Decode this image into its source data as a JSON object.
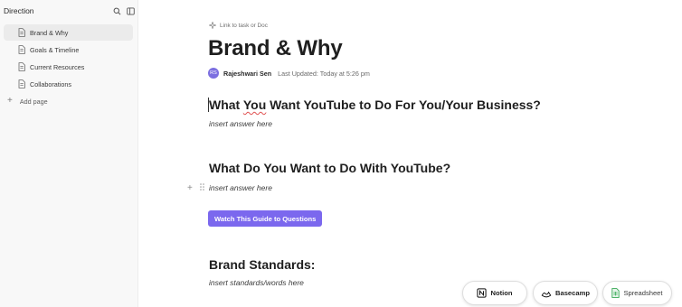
{
  "sidebar": {
    "title": "Direction",
    "items": [
      {
        "label": "Brand & Why",
        "active": true
      },
      {
        "label": "Goals & Timeline",
        "active": false
      },
      {
        "label": "Current Resources",
        "active": false
      },
      {
        "label": "Collaborations",
        "active": false
      }
    ],
    "add_page_label": "Add page",
    "icons": [
      "search-icon",
      "sidebar-toggle-icon",
      "document-icon",
      "plus-icon"
    ]
  },
  "doc": {
    "link_label": "Link to task or Doc",
    "title": "Brand & Why",
    "author_initials": "RS",
    "author": "Rajeshwari Sen",
    "last_updated": "Last Updated: Today at 5:26 pm",
    "q1_prefix": "What ",
    "q1_underlined": "You",
    "q1_suffix": " Want YouTube to Do For You/Your Business?",
    "answer1": "insert answer here",
    "q2": "What Do You Want to Do With YouTube?",
    "answer2": "insert answer here",
    "guide_button": "Watch This Guide to Questions",
    "h3": "Brand Standards:",
    "answer3": "insert standards/words here"
  },
  "integrations": {
    "notion": "Notion",
    "basecamp": "Basecamp",
    "spreadsheet": "Spreadsheet"
  },
  "colors": {
    "accent": "#7b68ee",
    "avatar": "#7c6fe0",
    "sidebar_bg": "#f8f8f8",
    "active_item_bg": "#ebebeb"
  }
}
